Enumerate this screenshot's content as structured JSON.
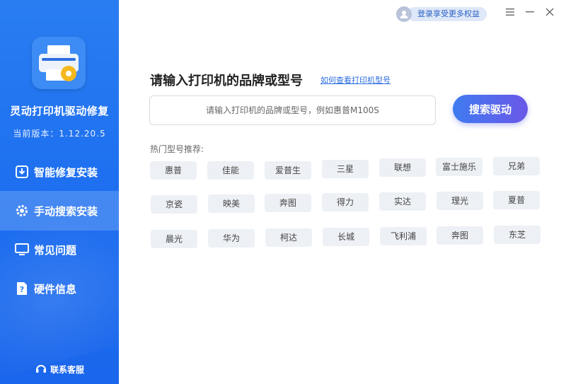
{
  "app": {
    "title": "灵动打印机驱动修复",
    "version": "当前版本：1.12.20.5"
  },
  "sidebar": {
    "items": [
      {
        "label": "智能修复安装",
        "icon": "download-box-icon",
        "active": false
      },
      {
        "label": "手动搜索安装",
        "icon": "settings-icon",
        "active": true
      },
      {
        "label": "常见问题",
        "icon": "monitor-icon",
        "active": false
      },
      {
        "label": "硬件信息",
        "icon": "question-doc-icon",
        "active": false
      }
    ],
    "contact_label": "联系客服"
  },
  "topbar": {
    "login_label": "登录享受更多权益"
  },
  "main": {
    "title": "请输入打印机的品牌或型号",
    "help_link": "如何查看打印机型号",
    "search_placeholder": "请输入打印机的品牌或型号，例如惠普M100S",
    "search_button": "搜索驱动",
    "hot_label": "热门型号推荐:",
    "tags": [
      "惠普",
      "佳能",
      "爱普生",
      "三星",
      "联想",
      "富士施乐",
      "兄弟",
      "京瓷",
      "映美",
      "奔图",
      "得力",
      "实达",
      "理光",
      "夏普",
      "晨光",
      "华为",
      "柯达",
      "长城",
      "飞利浦",
      "奔图",
      "东芝"
    ]
  },
  "colors": {
    "sidebar": "#1d6ff0",
    "accent_start": "#3f7bf0",
    "accent_end": "#6a58e8",
    "link": "#2b6cde",
    "tag_bg": "#edf0f5"
  }
}
